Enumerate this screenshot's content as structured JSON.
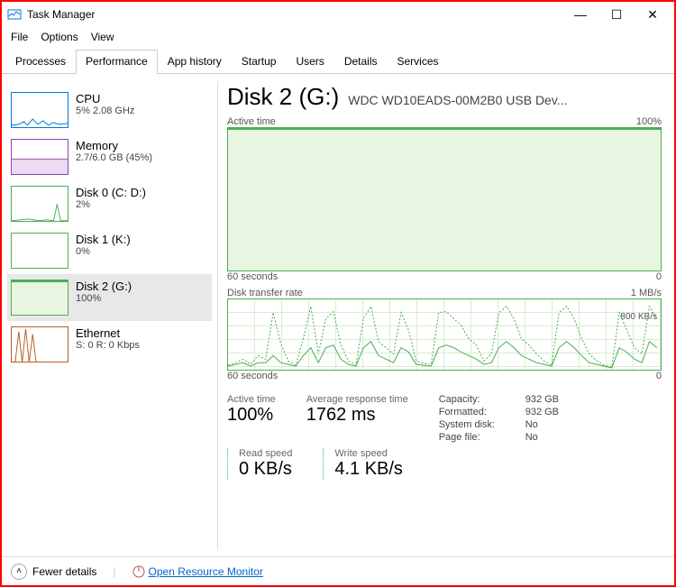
{
  "window": {
    "title": "Task Manager"
  },
  "menu": [
    "File",
    "Options",
    "View"
  ],
  "tabs": [
    "Processes",
    "Performance",
    "App history",
    "Startup",
    "Users",
    "Details",
    "Services"
  ],
  "activeTab": 1,
  "sidebar": [
    {
      "name": "CPU",
      "val": "5% 2.08 GHz",
      "color": "#0078d7"
    },
    {
      "name": "Memory",
      "val": "2.7/6.0 GB (45%)",
      "color": "#8e44ad"
    },
    {
      "name": "Disk 0 (C: D:)",
      "val": "2%",
      "color": "#4CAF50"
    },
    {
      "name": "Disk 1 (K:)",
      "val": "0%",
      "color": "#4CAF50"
    },
    {
      "name": "Disk 2 (G:)",
      "val": "100%",
      "color": "#4CAF50"
    },
    {
      "name": "Ethernet",
      "val": "S: 0 R: 0 Kbps",
      "color": "#b85c1e"
    }
  ],
  "selectedSidebar": 4,
  "header": {
    "title": "Disk 2 (G:)",
    "model": "WDC WD10EADS-00M2B0 USB Dev..."
  },
  "chart1": {
    "label": "Active time",
    "max": "100%",
    "xmin": "60 seconds",
    "xmax": "0"
  },
  "chart2": {
    "label": "Disk transfer rate",
    "max": "1 MB/s",
    "side": "800 KB/s",
    "xmin": "60 seconds",
    "xmax": "0"
  },
  "stats": {
    "activetime": {
      "lbl": "Active time",
      "v": "100%"
    },
    "avg": {
      "lbl": "Average response time",
      "v": "1762 ms"
    },
    "read": {
      "lbl": "Read speed",
      "v": "0 KB/s"
    },
    "write": {
      "lbl": "Write speed",
      "v": "4.1 KB/s"
    }
  },
  "capacity": [
    {
      "k": "Capacity:",
      "v": "932 GB"
    },
    {
      "k": "Formatted:",
      "v": "932 GB"
    },
    {
      "k": "System disk:",
      "v": "No"
    },
    {
      "k": "Page file:",
      "v": "No"
    }
  ],
  "status": {
    "fewer": "Fewer details",
    "monitor": "Open Resource Monitor"
  },
  "chart_data": [
    {
      "type": "line",
      "title": "Active time",
      "xlabel": "seconds ago",
      "ylabel": "%",
      "x_range": [
        60,
        0
      ],
      "ylim": [
        0,
        100
      ],
      "series": [
        {
          "name": "Active time %",
          "values": [
            100,
            100,
            100,
            100,
            100,
            100,
            100,
            100,
            100,
            100,
            100,
            100,
            100,
            100,
            100,
            100,
            100,
            100,
            100,
            100,
            100,
            100,
            100,
            100,
            100,
            100,
            100,
            100,
            100,
            100,
            100,
            100,
            100,
            100,
            100,
            100,
            100,
            100,
            100,
            100,
            100,
            100,
            100,
            100,
            100,
            100,
            100,
            100,
            100,
            100,
            100,
            100,
            100,
            100,
            100,
            100,
            100,
            100,
            100,
            100
          ]
        }
      ]
    },
    {
      "type": "line",
      "title": "Disk transfer rate",
      "xlabel": "seconds ago",
      "ylabel": "KB/s",
      "x_range": [
        60,
        0
      ],
      "ylim": [
        0,
        1000
      ],
      "annotations": [
        "800 KB/s"
      ],
      "series": [
        {
          "name": "Read",
          "values": [
            50,
            80,
            120,
            60,
            200,
            150,
            700,
            300,
            100,
            50,
            400,
            800,
            200,
            600,
            750,
            300,
            100,
            50,
            600,
            800,
            400,
            300,
            200,
            700,
            500,
            100,
            80,
            60,
            700,
            750,
            600,
            500,
            400,
            300,
            100,
            200,
            700,
            800,
            600,
            400,
            300,
            200,
            100,
            50,
            700,
            800,
            600,
            400,
            200,
            100,
            50,
            30,
            700,
            500,
            300,
            200,
            800,
            700,
            500,
            600
          ]
        },
        {
          "name": "Write",
          "values": [
            40,
            60,
            100,
            50,
            100,
            100,
            200,
            100,
            80,
            40,
            200,
            300,
            100,
            300,
            350,
            150,
            80,
            40,
            300,
            400,
            200,
            150,
            100,
            300,
            250,
            80,
            60,
            50,
            300,
            350,
            300,
            250,
            200,
            150,
            80,
            100,
            300,
            400,
            300,
            200,
            150,
            100,
            80,
            40,
            300,
            400,
            300,
            200,
            100,
            80,
            40,
            20,
            300,
            250,
            150,
            100,
            400,
            300,
            250,
            300
          ]
        }
      ]
    }
  ]
}
